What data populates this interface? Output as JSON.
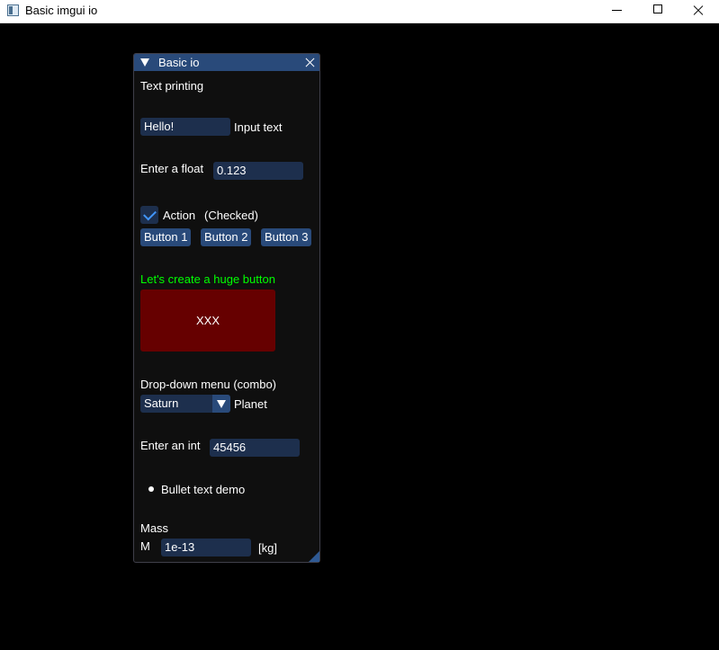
{
  "os_window": {
    "title": "Basic imgui io"
  },
  "imgui_window": {
    "title": "Basic io",
    "text_printing": "Text printing",
    "input_text": {
      "value": "Hello!",
      "label": "Input text"
    },
    "float_input": {
      "label": "Enter a float",
      "value": "0.123"
    },
    "checkbox": {
      "label": "Action",
      "checked": true,
      "status": "(Checked)"
    },
    "buttons": [
      "Button 1",
      "Button 2",
      "Button 3"
    ],
    "huge_button": {
      "caption": "Let's create a huge button",
      "label": "XXX",
      "caption_color": "#00ff00",
      "color": "#660000"
    },
    "combo": {
      "caption": "Drop-down menu (combo)",
      "selected": "Saturn",
      "label": "Planet"
    },
    "int_input": {
      "label": "Enter an int",
      "value": "45456"
    },
    "bullet_text": "Bullet text demo",
    "mass": {
      "header": "Mass",
      "symbol": "M",
      "value": "1e-13",
      "unit": "[kg]"
    }
  },
  "colors": {
    "title_bg": "#294a7a",
    "frame_bg": "#1d2f4d",
    "button": "#294a7a",
    "check": "#4296fa",
    "window_bg": "#0f0f0f"
  }
}
